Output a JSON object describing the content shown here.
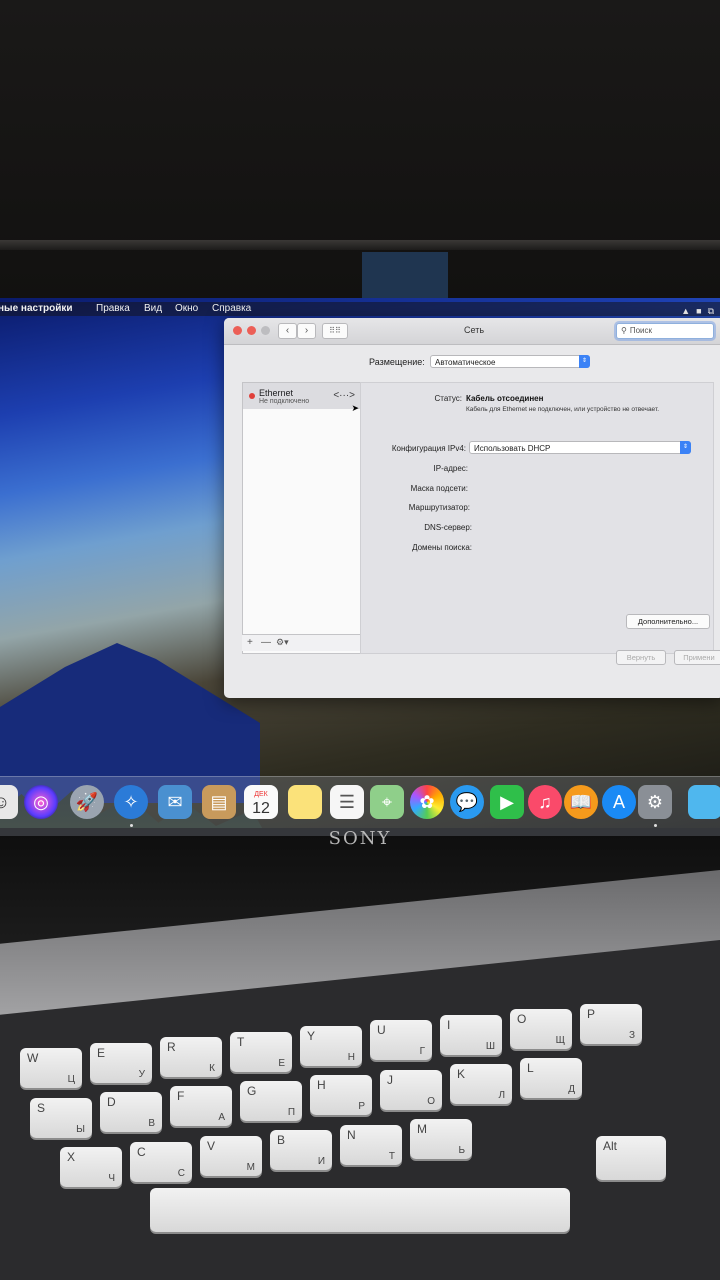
{
  "menubar": {
    "app_name": "ные настройки",
    "items": [
      "Правка",
      "Вид",
      "Окно",
      "Справка"
    ]
  },
  "window": {
    "title": "Сеть",
    "search_placeholder": "Поиск",
    "location_label": "Размещение:",
    "location_value": "Автоматическое"
  },
  "sidebar": {
    "service_name": "Ethernet",
    "service_status": "Не подключено",
    "toolbar": {
      "add": "+",
      "remove": "—",
      "action": "⚙▾"
    }
  },
  "panel": {
    "status_label": "Статус:",
    "status_value": "Кабель отсоединен",
    "status_detail": "Кабель для Ethernet не подключен, или устройство не отвечает.",
    "ipv4_label": "Конфигурация IPv4:",
    "ipv4_value": "Использовать DHCP",
    "fields": [
      "IP-адрес:",
      "Маска подсети:",
      "Маршрутизатор:",
      "DNS-сервер:",
      "Домены поиска:"
    ],
    "advanced_button": "Дополнительно...",
    "revert_button": "Вернуть",
    "apply_button": "Примени"
  },
  "dock": {
    "icons": [
      "finder-icon",
      "siri-icon",
      "launchpad-icon",
      "safari-icon",
      "mail-icon",
      "contacts-icon",
      "calendar-icon",
      "notes-icon",
      "reminders-icon",
      "maps-icon",
      "photos-icon",
      "messages-icon",
      "facetime-icon",
      "music-icon",
      "books-icon",
      "app-store-icon",
      "system-preferences-icon",
      "folder-icon"
    ],
    "calendar_month": "ДЕК",
    "calendar_day": "12"
  },
  "hardware": {
    "brand": "SONY"
  },
  "keyboard": {
    "rows": [
      [
        [
          "W",
          "Ц"
        ],
        [
          "E",
          "У"
        ],
        [
          "R",
          "К"
        ],
        [
          "T",
          "Е"
        ],
        [
          "Y",
          "Н"
        ],
        [
          "U",
          "Г"
        ],
        [
          "I",
          "Ш"
        ],
        [
          "O",
          "Щ"
        ],
        [
          "P",
          "З"
        ]
      ],
      [
        [
          "S",
          "Ы"
        ],
        [
          "D",
          "В"
        ],
        [
          "F",
          "А"
        ],
        [
          "G",
          "П"
        ],
        [
          "H",
          "Р"
        ],
        [
          "J",
          "О"
        ],
        [
          "K",
          "Л"
        ],
        [
          "L",
          "Д"
        ]
      ],
      [
        [
          "X",
          "Ч"
        ],
        [
          "C",
          "С"
        ],
        [
          "V",
          "М"
        ],
        [
          "B",
          "И"
        ],
        [
          "N",
          "Т"
        ],
        [
          "M",
          "Ь"
        ]
      ]
    ],
    "alt": "Alt"
  }
}
